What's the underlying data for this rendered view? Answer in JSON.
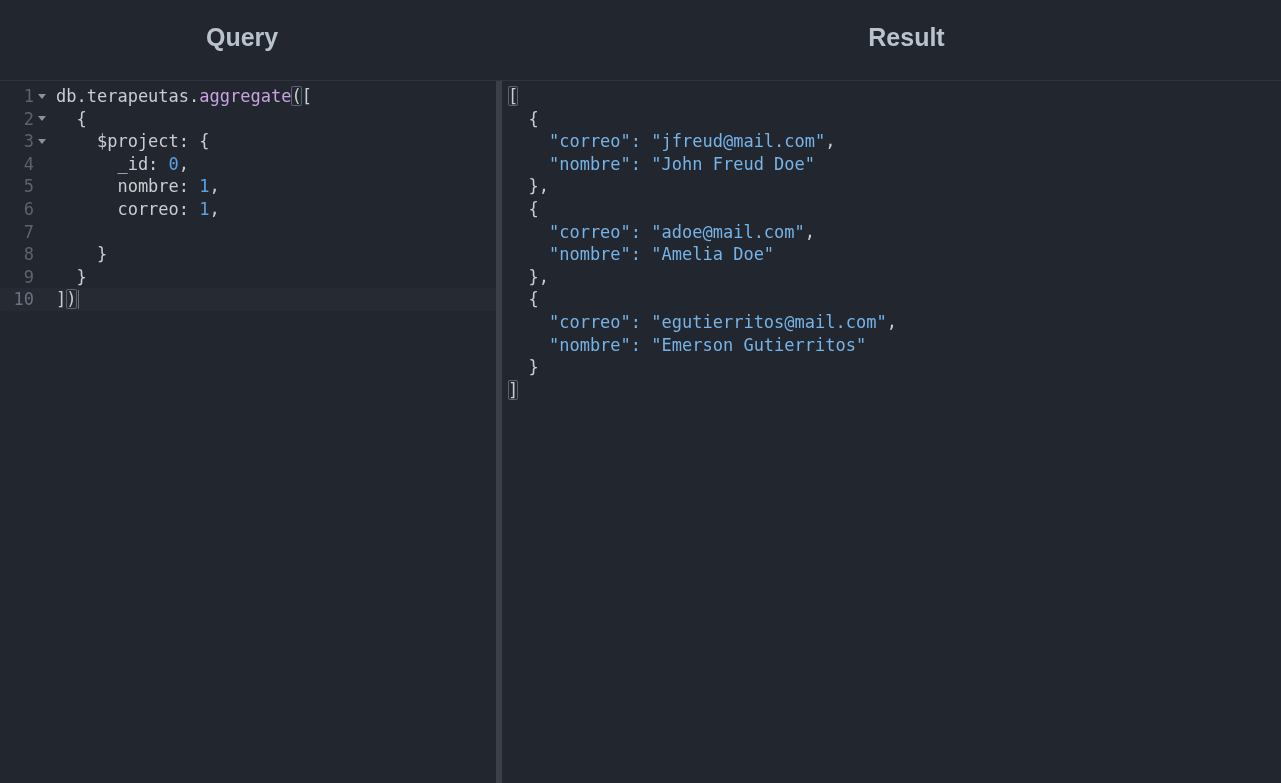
{
  "query_panel": {
    "title": "Query",
    "lines": [
      {
        "number": "1",
        "foldable": true,
        "active": false,
        "tokens": [
          {
            "text": "db.terapeutas.",
            "kind": "plain"
          },
          {
            "text": "aggregate",
            "kind": "function"
          },
          {
            "text": "(",
            "kind": "match"
          },
          {
            "text": "[",
            "kind": "plain"
          }
        ]
      },
      {
        "number": "2",
        "foldable": true,
        "active": false,
        "tokens": [
          {
            "text": "  {",
            "kind": "plain"
          }
        ]
      },
      {
        "number": "3",
        "foldable": true,
        "active": false,
        "tokens": [
          {
            "text": "    $project: {",
            "kind": "plain"
          }
        ]
      },
      {
        "number": "4",
        "foldable": false,
        "active": false,
        "tokens": [
          {
            "text": "      _id: ",
            "kind": "plain"
          },
          {
            "text": "0",
            "kind": "number"
          },
          {
            "text": ",",
            "kind": "plain"
          }
        ]
      },
      {
        "number": "5",
        "foldable": false,
        "active": false,
        "tokens": [
          {
            "text": "      nombre: ",
            "kind": "plain"
          },
          {
            "text": "1",
            "kind": "number"
          },
          {
            "text": ",",
            "kind": "plain"
          }
        ]
      },
      {
        "number": "6",
        "foldable": false,
        "active": false,
        "tokens": [
          {
            "text": "      correo: ",
            "kind": "plain"
          },
          {
            "text": "1",
            "kind": "number"
          },
          {
            "text": ",",
            "kind": "plain"
          }
        ]
      },
      {
        "number": "7",
        "foldable": false,
        "active": false
      },
      {
        "number": "8",
        "foldable": false,
        "active": false,
        "tokens": [
          {
            "text": "    }",
            "kind": "plain"
          }
        ]
      },
      {
        "number": "9",
        "foldable": false,
        "active": false,
        "tokens": [
          {
            "text": "  }",
            "kind": "plain"
          }
        ]
      },
      {
        "number": "10",
        "foldable": false,
        "active": true,
        "tokens": [
          {
            "text": "]",
            "kind": "plain"
          },
          {
            "text": ")",
            "kind": "match"
          }
        ]
      }
    ]
  },
  "result_panel": {
    "title": "Result",
    "lines": [
      [
        {
          "text": "[",
          "kind": "match"
        }
      ],
      [
        {
          "text": "  {",
          "kind": "plain"
        }
      ],
      [
        {
          "text": "    \"correo\": \"jfreud@mail.com\"",
          "kind": "string"
        },
        {
          "text": ",",
          "kind": "plain"
        }
      ],
      [
        {
          "text": "    \"nombre\": \"John Freud Doe\"",
          "kind": "string"
        }
      ],
      [
        {
          "text": "  },",
          "kind": "plain"
        }
      ],
      [
        {
          "text": "  {",
          "kind": "plain"
        }
      ],
      [
        {
          "text": "    \"correo\": \"adoe@mail.com\"",
          "kind": "string"
        },
        {
          "text": ",",
          "kind": "plain"
        }
      ],
      [
        {
          "text": "    \"nombre\": \"Amelia Doe\"",
          "kind": "string"
        }
      ],
      [
        {
          "text": "  },",
          "kind": "plain"
        }
      ],
      [
        {
          "text": "  {",
          "kind": "plain"
        }
      ],
      [
        {
          "text": "    \"correo\": \"egutierritos@mail.com\"",
          "kind": "string"
        },
        {
          "text": ",",
          "kind": "plain"
        }
      ],
      [
        {
          "text": "    \"nombre\": \"Emerson Gutierritos\"",
          "kind": "string"
        }
      ],
      [
        {
          "text": "  }",
          "kind": "plain"
        }
      ],
      [
        {
          "text": "]",
          "kind": "match"
        }
      ]
    ]
  }
}
